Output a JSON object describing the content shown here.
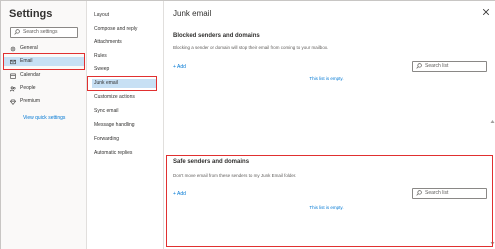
{
  "left": {
    "title": "Settings",
    "search_placeholder": "Search settings",
    "items": [
      {
        "label": "General"
      },
      {
        "label": "Email"
      },
      {
        "label": "Calendar"
      },
      {
        "label": "People"
      },
      {
        "label": "Premium"
      }
    ],
    "view_quick": "View quick settings"
  },
  "middle": {
    "items": [
      {
        "label": "Layout"
      },
      {
        "label": "Compose and reply"
      },
      {
        "label": "Attachments"
      },
      {
        "label": "Rules"
      },
      {
        "label": "Sweep"
      },
      {
        "label": "Junk email"
      },
      {
        "label": "Customize actions"
      },
      {
        "label": "Sync email"
      },
      {
        "label": "Message handling"
      },
      {
        "label": "Forwarding"
      },
      {
        "label": "Automatic replies"
      }
    ]
  },
  "main": {
    "title": "Junk email",
    "blocked": {
      "title": "Blocked senders and domains",
      "desc": "Blocking a sender or domain will stop their email from coming to your mailbox.",
      "add": "+ Add",
      "search_placeholder": "Search list",
      "empty": "This list is empty."
    },
    "safe": {
      "title": "Safe senders and domains",
      "desc": "Don't move email from these senders to my Junk Email folder.",
      "add": "+ Add",
      "search_placeholder": "Search list",
      "empty": "This list is empty."
    }
  },
  "colors": {
    "accent": "#0078d4",
    "selected_bg": "#c7e0f4",
    "highlight": "#e03030"
  }
}
